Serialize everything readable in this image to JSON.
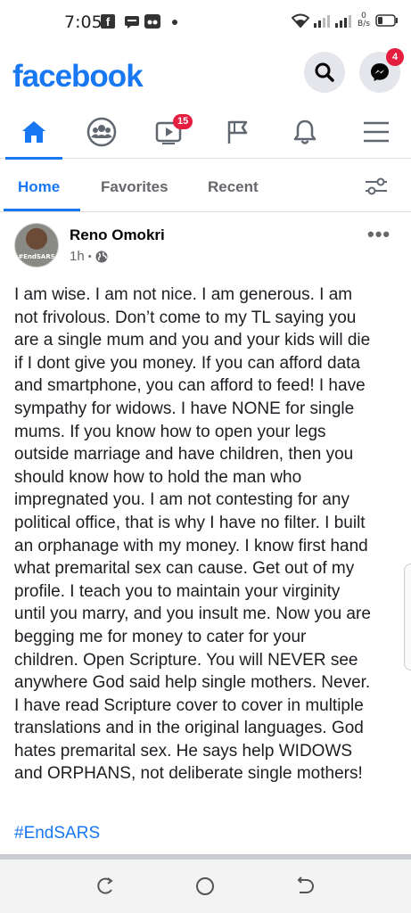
{
  "status_bar": {
    "time": "7:05",
    "fb_notification": "f",
    "data_speed_value": "0",
    "data_speed_unit": "B/s"
  },
  "header": {
    "logo": "facebook",
    "messenger_badge": "4",
    "search_icon": "search-icon",
    "messenger_icon": "messenger-icon"
  },
  "nav": {
    "items": [
      {
        "name": "home",
        "icon": "home-icon",
        "active": true
      },
      {
        "name": "groups",
        "icon": "groups-icon"
      },
      {
        "name": "watch",
        "icon": "video-icon",
        "badge": "15"
      },
      {
        "name": "pages",
        "icon": "flag-icon"
      },
      {
        "name": "notifications",
        "icon": "bell-icon"
      },
      {
        "name": "menu",
        "icon": "hamburger-icon"
      }
    ]
  },
  "feed_tabs": {
    "home": "Home",
    "favorites": "Favorites",
    "recent": "Recent"
  },
  "post": {
    "author": "Reno Omokri",
    "time": "1h",
    "separator": "•",
    "avatar_text": "#EndSARS",
    "more": "•••",
    "lines": [
      "I am wise. I am not nice. I am generous. I am",
      "not frivolous. Don’t come to my TL saying you",
      "are a single mum and you and your kids will die",
      "if I dont give you money. If you can afford data",
      "and smartphone, you can afford to feed! I have",
      "sympathy for widows. I have NONE for single",
      "mums. If you know how to open your legs",
      "outside marriage and have children, then you",
      "should know how to hold the man who",
      "impregnated you. I am not contesting for any",
      "political office, that is why I have no filter. I built",
      "an orphanage with my money. I know first hand",
      "what premarital sex can cause. Get out of my",
      "profile. I teach you to maintain your virginity",
      "until you marry, and you insult me. Now you are",
      "begging me for money to cater for your",
      "children. Open Scripture. You will NEVER see",
      "anywhere God said help single mothers. Never.",
      "I have read Scripture cover to cover in multiple",
      "translations and in the original languages. God",
      "hates premarital sex. He says help WIDOWS",
      "and ORPHANS, not deliberate single mothers!"
    ],
    "hashtag": "#EndSARS"
  },
  "colors": {
    "brand": "#1877f2",
    "badge": "#e41e3f",
    "secondary_text": "#65676b"
  }
}
